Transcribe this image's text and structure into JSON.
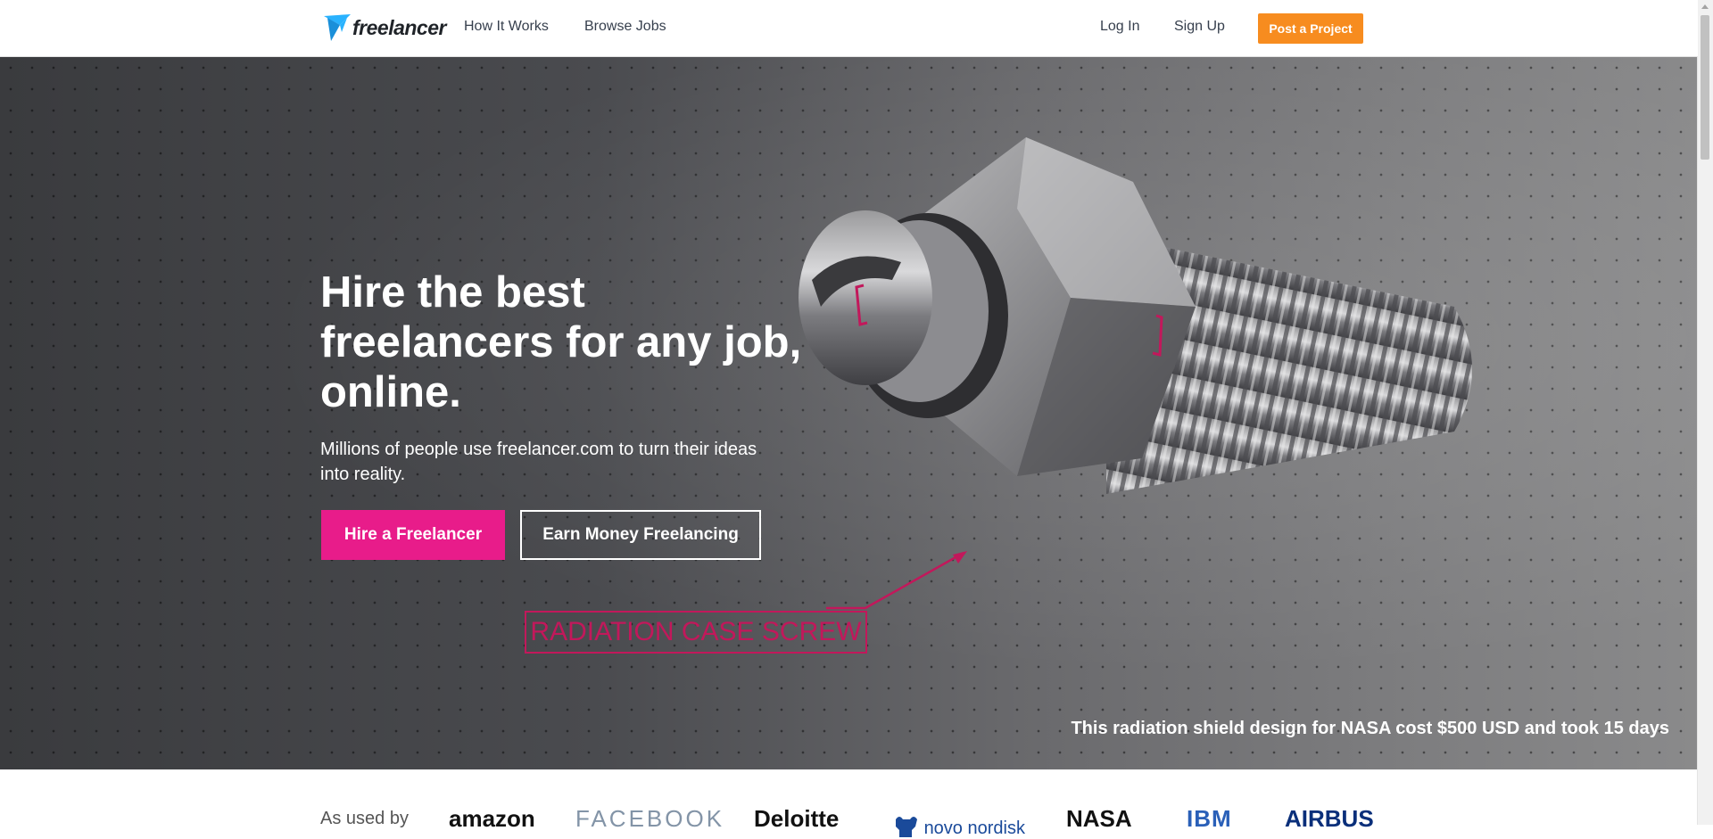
{
  "nav": {
    "logo_text": "freelancer",
    "links": [
      "How It Works",
      "Browse Jobs"
    ],
    "login": "Log In",
    "signup": "Sign Up",
    "post_project": "Post a Project"
  },
  "hero": {
    "headline": "Hire the best freelancers for any job, online.",
    "subline": "Millions of people use freelancer.com to turn their ideas into reality.",
    "hire_button": "Hire a Freelancer",
    "earn_button": "Earn Money Freelancing",
    "annotation": "RADIATION CASE SCREW",
    "caption": "This radiation shield design for NASA cost $500 USD and took 15 days"
  },
  "used_by": {
    "label": "As used by",
    "clients": [
      "amazon",
      "FACEBOOK",
      "Deloitte",
      "novo nordisk",
      "NASA",
      "IBM",
      "AIRBUS"
    ]
  },
  "colors": {
    "accent_pink": "#e81c8a",
    "accent_orange": "#f78c1f",
    "logo_blue": "#29b2fe"
  }
}
